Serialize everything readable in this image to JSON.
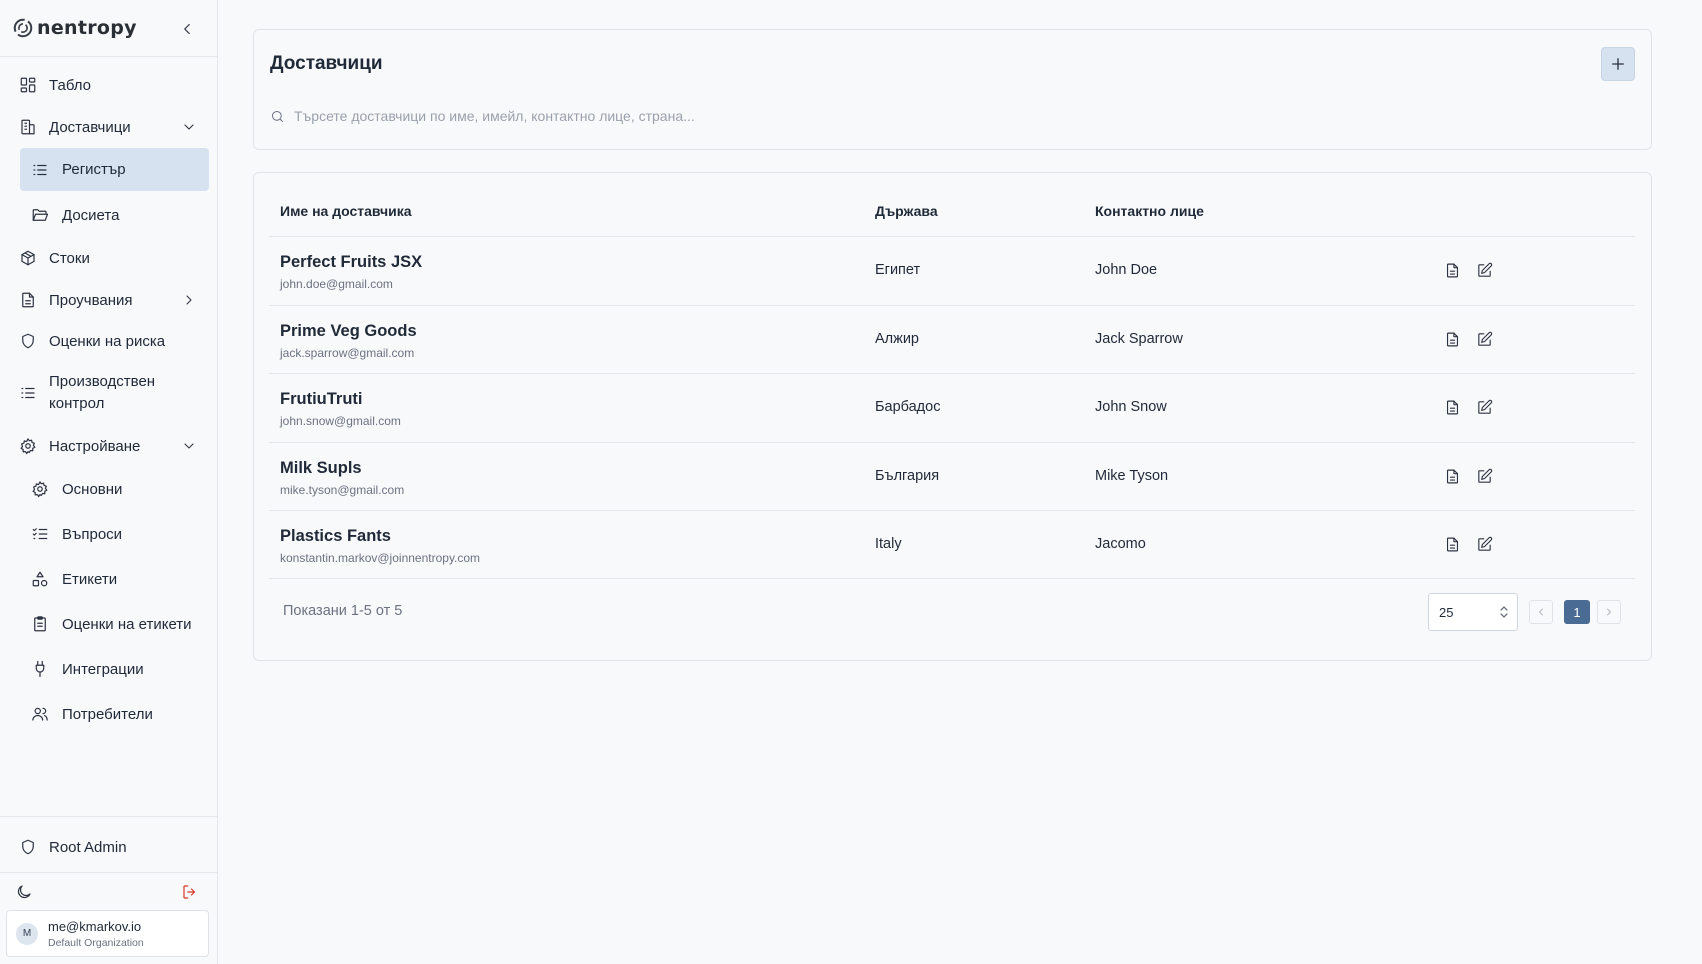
{
  "brand": {
    "name": "nentropy"
  },
  "sidebar": {
    "items": [
      {
        "label": "Табло"
      },
      {
        "label": "Доставчици"
      },
      {
        "label": "Регистър"
      },
      {
        "label": "Досиета"
      },
      {
        "label": "Стоки"
      },
      {
        "label": "Проучвания"
      },
      {
        "label": "Оценки на риска"
      },
      {
        "label": "Производствен контрол"
      },
      {
        "label": "Настройване"
      },
      {
        "label": "Основни"
      },
      {
        "label": "Въпроси"
      },
      {
        "label": "Етикети"
      },
      {
        "label": "Оценки на етикети"
      },
      {
        "label": "Интеграции"
      },
      {
        "label": "Потребители"
      }
    ],
    "root_admin": "Root Admin"
  },
  "user": {
    "initial": "M",
    "email": "me@kmarkov.io",
    "org": "Default Organization"
  },
  "page": {
    "title": "Доставчици",
    "search_placeholder": "Търсете доставчици по име, имейл, контактно лице, страна..."
  },
  "table": {
    "headers": {
      "name": "Име на доставчика",
      "country": "Държава",
      "contact": "Контактно лице"
    },
    "rows": [
      {
        "name": "Perfect Fruits JSX",
        "email": "john.doe@gmail.com",
        "country": "Египет",
        "contact": "John Doe"
      },
      {
        "name": "Prime Veg Goods",
        "email": "jack.sparrow@gmail.com",
        "country": "Алжир",
        "contact": "Jack Sparrow"
      },
      {
        "name": "FrutiuTruti",
        "email": "john.snow@gmail.com",
        "country": "Барбадос",
        "contact": "John Snow"
      },
      {
        "name": "Milk Supls",
        "email": "mike.tyson@gmail.com",
        "country": "България",
        "contact": "Mike Tyson"
      },
      {
        "name": "Plastics Fants",
        "email": "konstantin.markov@joinnentropy.com",
        "country": "Italy",
        "contact": "Jacomo"
      }
    ]
  },
  "pagination": {
    "info": "Показани 1-5 от 5",
    "page_size": "25",
    "current_page": "1"
  },
  "colors": {
    "accent": "#4a6b93",
    "active_bg": "#d6e2ef",
    "logout": "#d9362b"
  }
}
